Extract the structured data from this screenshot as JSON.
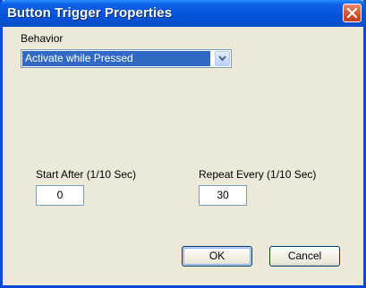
{
  "window": {
    "title": "Button Trigger Properties"
  },
  "behavior": {
    "label": "Behavior",
    "selected": "Activate while Pressed"
  },
  "start_after": {
    "label": "Start After (1/10 Sec)",
    "value": "0"
  },
  "repeat_every": {
    "label": "Repeat Every (1/10 Sec)",
    "value": "30"
  },
  "buttons": {
    "ok": "OK",
    "cancel": "Cancel"
  },
  "colors": {
    "titlebar": "#0753d8",
    "selection": "#316ac5",
    "face": "#ece9d8",
    "close": "#d6532d"
  },
  "icons": {
    "close": "close-icon",
    "dropdown": "chevron-down-icon"
  }
}
